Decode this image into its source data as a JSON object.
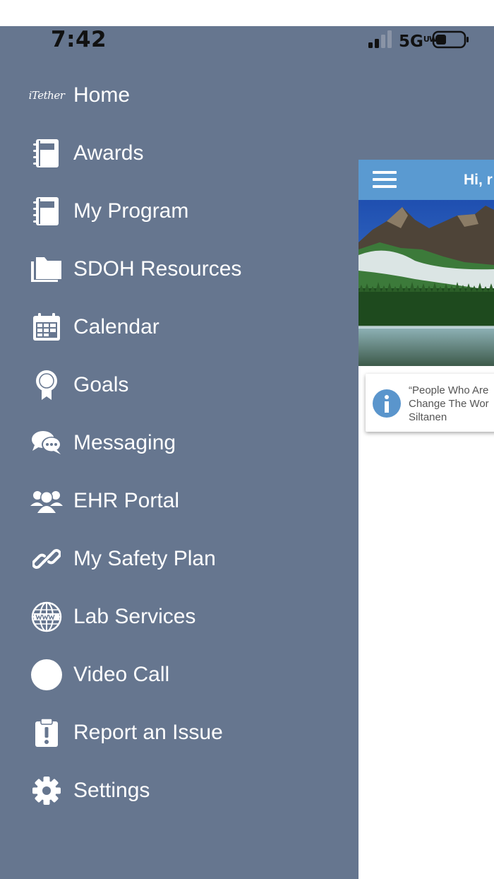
{
  "status_bar": {
    "time": "7:42",
    "network": "5G",
    "network_sup": "UW"
  },
  "drawer": {
    "brand": "iTether",
    "items": [
      {
        "label": "Home",
        "icon": "itether-logo"
      },
      {
        "label": "Awards",
        "icon": "notebook-icon"
      },
      {
        "label": "My Program",
        "icon": "notebook-icon"
      },
      {
        "label": "SDOH Resources",
        "icon": "folders-icon"
      },
      {
        "label": "Calendar",
        "icon": "calendar-icon"
      },
      {
        "label": "Goals",
        "icon": "ribbon-award-icon"
      },
      {
        "label": "Messaging",
        "icon": "chat-bubbles-icon"
      },
      {
        "label": "EHR Portal",
        "icon": "users-group-icon"
      },
      {
        "label": "My Safety Plan",
        "icon": "link-icon"
      },
      {
        "label": "Lab Services",
        "icon": "globe-www-icon"
      },
      {
        "label": "Video Call",
        "icon": "circle-icon"
      },
      {
        "label": "Report an Issue",
        "icon": "clipboard-exclamation-icon"
      },
      {
        "label": "Settings",
        "icon": "gear-icon"
      }
    ]
  },
  "app": {
    "greeting": "Hi, r",
    "quote": "“People Who Are\nChange The Wor\nSiltanen"
  },
  "colors": {
    "drawer_bg": "#66768f",
    "header_bg": "#5a9ad1",
    "info_icon": "#5a95cc"
  }
}
